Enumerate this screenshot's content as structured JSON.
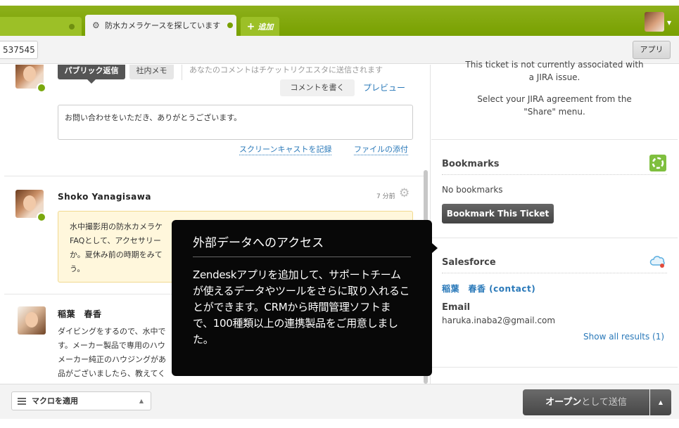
{
  "tabs": {
    "active_label": "防水カメラケースを探しています",
    "add_label": "追加"
  },
  "toolbar": {
    "ticket_id": "537545",
    "apps_label": "アプリ"
  },
  "composer": {
    "public_reply": "パブリック返信",
    "internal_note": "社内メモ",
    "hint": "あなたのコメントはチケットリクエスタに送信されます",
    "write_comment": "コメントを書く",
    "preview": "プレビュー",
    "body": "お問い合わせをいただき、ありがとうございます。",
    "screencast_link": "スクリーンキャストを記録",
    "attach_link": "ファイルの添付"
  },
  "comments": [
    {
      "author": "Shoko Yanagisawa",
      "time": "7 分前",
      "lines": [
        "水中撮影用の防水カメラケ",
        "FAQとして、アクセサリー",
        "か。夏休み前の時期をみて",
        "う。"
      ]
    },
    {
      "author": "稲葉　春香",
      "lines": [
        "ダイビングをするので、水中で",
        "す。メーカー製品で専用のハウ",
        "メーカー純正のハウジングがあ",
        "品がございましたら、教えてく"
      ]
    }
  ],
  "sidebar": {
    "jira_line1": "This ticket is not currently associated with",
    "jira_line2": "a JIRA issue.",
    "jira_line3": "Select your JIRA agreement from the",
    "jira_line4": "\"Share\" menu.",
    "bookmarks_title": "Bookmarks",
    "no_bookmarks": "No bookmarks",
    "bookmark_button": "Bookmark This Ticket",
    "salesforce_title": "Salesforce",
    "contact_link": "稲葉　春香 (contact)",
    "email_label": "Email",
    "email_value": "haruka.inaba2@gmail.com",
    "show_all": "Show all results (1)"
  },
  "footer": {
    "macro_label": "マクロを適用",
    "submit_bold": "オープン",
    "submit_rest": "として送信"
  },
  "tooltip": {
    "title": "外部データへのアクセス",
    "body": "Zendeskアプリを追加して、サポートチームが使えるデータやツールをさらに取り入れることができます。CRMから時間管理ソフトまで、100種類以上の連携製品をご用意しました。"
  },
  "colors": {
    "brand_green": "#78a000",
    "link_blue": "#2a79b9",
    "tooltip_bg": "#080808"
  }
}
